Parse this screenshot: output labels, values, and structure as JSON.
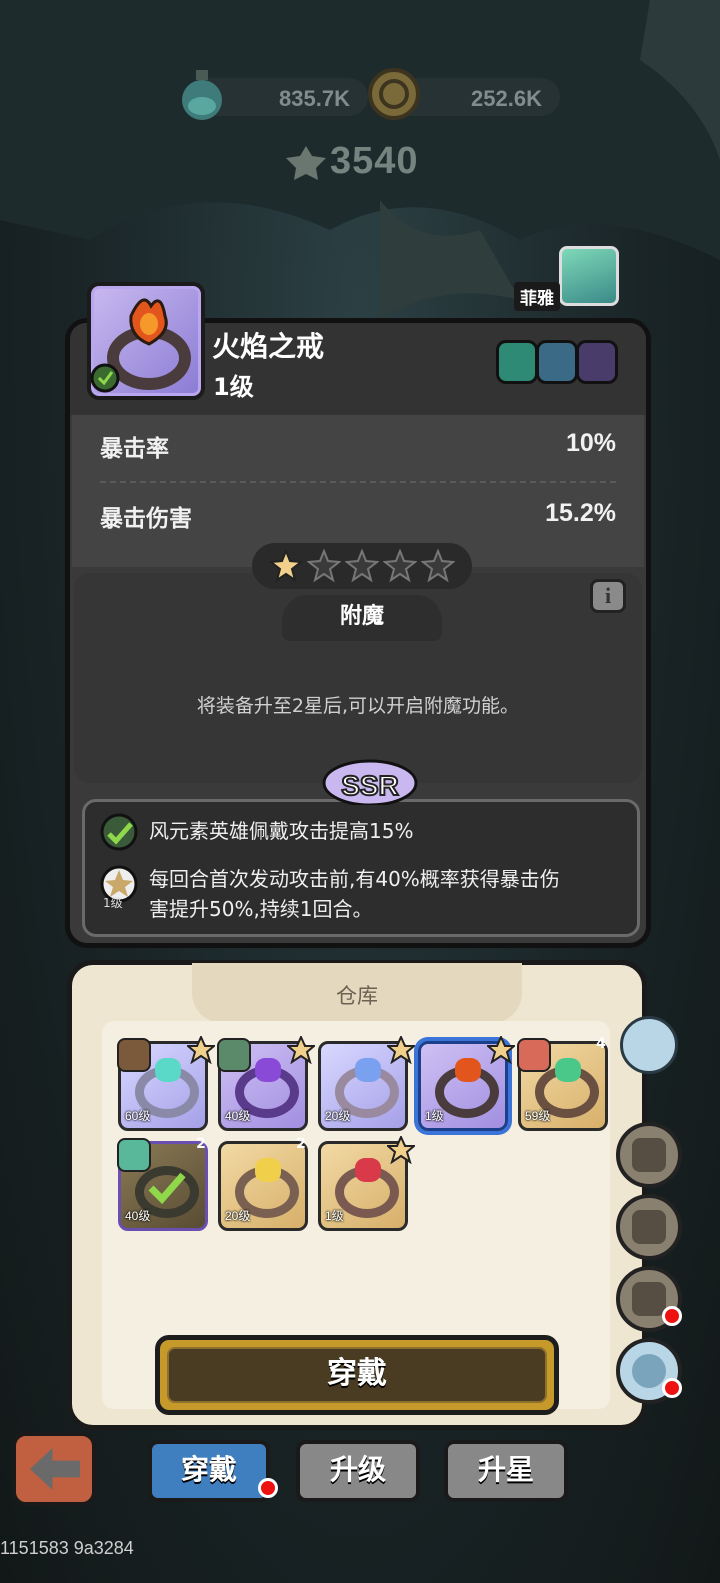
{
  "resources": {
    "potion": "835.7K",
    "coin": "252.6K",
    "power": "3540"
  },
  "hero": {
    "name": "菲雅"
  },
  "equipment": {
    "name": "火焰之戒",
    "level": "1级",
    "stats": [
      {
        "label": "暴击率",
        "value": "10%"
      },
      {
        "label": "暴击伤害",
        "value": "15.2%"
      }
    ],
    "stars_filled": 1,
    "stars_total": 5
  },
  "enchant": {
    "title": "附魔",
    "message": "将装备升至2星后,可以开启附魔功能。"
  },
  "rarity": "SSR",
  "skills": [
    {
      "text": "风元素英雄佩戴攻击提高15%"
    },
    {
      "level": "1级",
      "text_line1": "每回合首次发动攻击前,有40%概率获得暴击伤",
      "text_line2": "害提升50%,持续1回合。"
    }
  ],
  "warehouse": {
    "title": "仓库",
    "items": [
      {
        "level": "60级",
        "stars": "1"
      },
      {
        "level": "40级",
        "stars": "1"
      },
      {
        "level": "20级",
        "stars": "1"
      },
      {
        "level": "1级",
        "stars": "1"
      },
      {
        "level": "59级",
        "stars": "4"
      },
      {
        "level": "40级",
        "stars": "2"
      },
      {
        "level": "20级",
        "stars": "2"
      },
      {
        "level": "1级",
        "stars": "1"
      }
    ]
  },
  "actions": {
    "wear": "穿戴"
  },
  "tabs": [
    {
      "label": "穿戴"
    },
    {
      "label": "升级"
    },
    {
      "label": "升星"
    }
  ],
  "watermark": "1151583 9a3284",
  "colors": {
    "accent_gold": "#c59a2a",
    "tab_active": "#3f7fc0",
    "reddot": "#ee1111"
  }
}
